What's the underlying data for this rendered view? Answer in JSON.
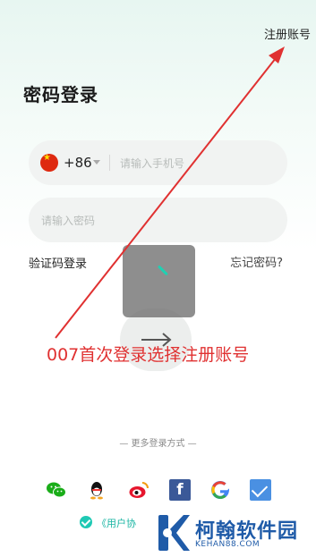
{
  "header": {
    "register_link": "注册账号",
    "title": "密码登录"
  },
  "phone": {
    "country_code": "+86",
    "placeholder": "请输入手机号"
  },
  "password": {
    "placeholder": "请输入密码"
  },
  "links": {
    "sms_login": "验证码登录",
    "forgot_password": "忘记密码?"
  },
  "annotation": "007首次登录选择注册账号",
  "more_login": "— 更多登录方式 —",
  "social_icons": [
    "wechat-icon",
    "qq-icon",
    "weibo-icon",
    "facebook-icon",
    "google-icon",
    "mail-icon"
  ],
  "social": {
    "facebook_glyph": "f",
    "google_glyph": "G"
  },
  "agreement": "《用户协",
  "watermark": {
    "name": "柯翰软件园",
    "url": "KEHAN88.COM"
  },
  "colors": {
    "accent": "#1fc9b4",
    "annotation": "#e03131",
    "watermark": "#1f5ba8"
  }
}
